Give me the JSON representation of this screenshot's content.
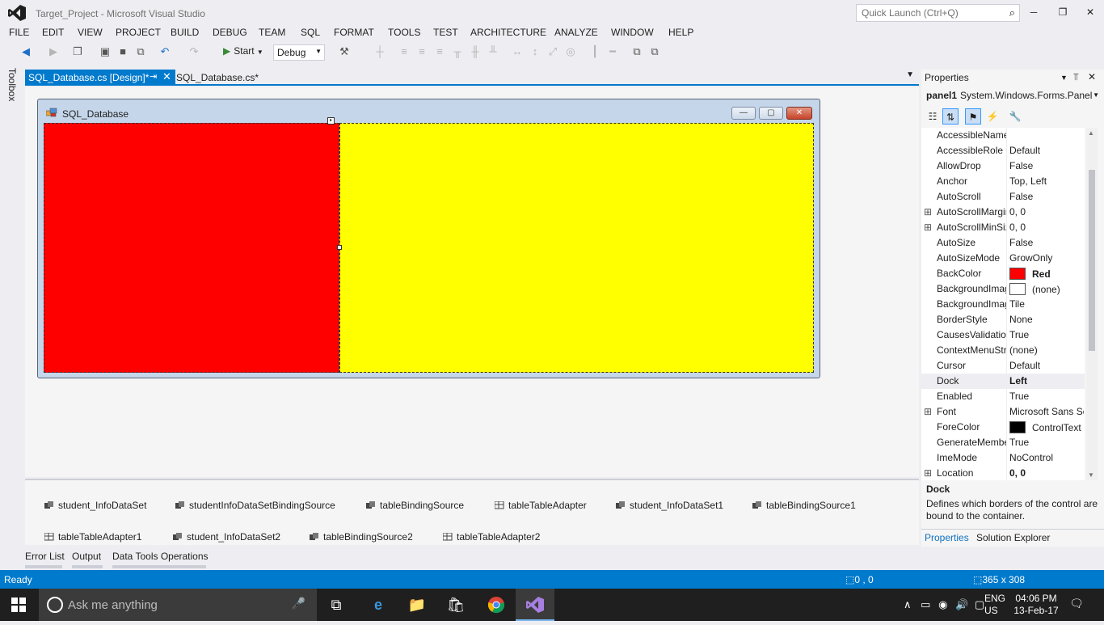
{
  "window": {
    "title": "Target_Project - Microsoft Visual Studio",
    "quick_launch_placeholder": "Quick Launch (Ctrl+Q)",
    "controls": {
      "minimize": "─",
      "restore": "❐",
      "close": "✕"
    }
  },
  "menu": [
    "FILE",
    "EDIT",
    "VIEW",
    "PROJECT",
    "BUILD",
    "DEBUG",
    "TEAM",
    "SQL",
    "FORMAT",
    "TOOLS",
    "TEST",
    "ARCHITECTURE",
    "ANALYZE",
    "WINDOW",
    "HELP"
  ],
  "toolbar": {
    "start_label": "Start",
    "configuration": "Debug"
  },
  "toolbox": {
    "label": "Toolbox"
  },
  "tabs": {
    "active": "SQL_Database.cs [Design]*",
    "inactive": "SQL_Database.cs*"
  },
  "designer": {
    "form_title": "SQL_Database",
    "panels": {
      "left_color": "#ff0000",
      "right_color": "#ffff00"
    }
  },
  "component_tray": [
    "student_InfoDataSet",
    "studentInfoDataSetBindingSource",
    "tableBindingSource",
    "tableTableAdapter",
    "student_InfoDataSet1",
    "tableBindingSource1",
    "tableTableAdapter1",
    "student_InfoDataSet2",
    "tableBindingSource2",
    "tableTableAdapter2"
  ],
  "bottom_tabs": [
    "Error List",
    "Output",
    "Data Tools Operations"
  ],
  "properties": {
    "header": "Properties",
    "object_name": "panel1",
    "object_type": "System.Windows.Forms.Panel",
    "rows": [
      {
        "name": "AccessibleName",
        "value": "",
        "expand": false
      },
      {
        "name": "AccessibleRole",
        "value": "Default",
        "expand": false
      },
      {
        "name": "AllowDrop",
        "value": "False",
        "expand": false
      },
      {
        "name": "Anchor",
        "value": "Top, Left",
        "expand": false
      },
      {
        "name": "AutoScroll",
        "value": "False",
        "expand": false
      },
      {
        "name": "AutoScrollMargin",
        "value": "0, 0",
        "expand": true
      },
      {
        "name": "AutoScrollMinSize",
        "value": "0, 0",
        "expand": true
      },
      {
        "name": "AutoSize",
        "value": "False",
        "expand": false
      },
      {
        "name": "AutoSizeMode",
        "value": "GrowOnly",
        "expand": false
      },
      {
        "name": "BackColor",
        "value": "Red",
        "expand": false,
        "swatch": "#ff0000",
        "bold": true
      },
      {
        "name": "BackgroundImage",
        "value": "(none)",
        "expand": false,
        "swatch": "#ffffff"
      },
      {
        "name": "BackgroundImageLayout",
        "value": "Tile",
        "expand": false
      },
      {
        "name": "BorderStyle",
        "value": "None",
        "expand": false
      },
      {
        "name": "CausesValidation",
        "value": "True",
        "expand": false
      },
      {
        "name": "ContextMenuStrip",
        "value": "(none)",
        "expand": false
      },
      {
        "name": "Cursor",
        "value": "Default",
        "expand": false
      },
      {
        "name": "Dock",
        "value": "Left",
        "expand": false,
        "bold": true,
        "highlight": true
      },
      {
        "name": "Enabled",
        "value": "True",
        "expand": false
      },
      {
        "name": "Font",
        "value": "Microsoft Sans Serif",
        "expand": true
      },
      {
        "name": "ForeColor",
        "value": "ControlText",
        "expand": false,
        "swatch": "#000000"
      },
      {
        "name": "GenerateMember",
        "value": "True",
        "expand": false
      },
      {
        "name": "ImeMode",
        "value": "NoControl",
        "expand": false
      },
      {
        "name": "Location",
        "value": "0, 0",
        "expand": true,
        "bold": true
      }
    ],
    "description_title": "Dock",
    "description_text": "Defines which borders of the control are bound to the container.",
    "bottom_tabs": [
      "Properties",
      "Solution Explorer"
    ]
  },
  "status": {
    "text": "Ready",
    "position": "0 , 0",
    "size": "365 x 308"
  },
  "taskbar": {
    "search_placeholder": "Ask me anything",
    "language_top": "ENG",
    "language_bottom": "US",
    "time": "04:06 PM",
    "date": "13-Feb-17"
  }
}
